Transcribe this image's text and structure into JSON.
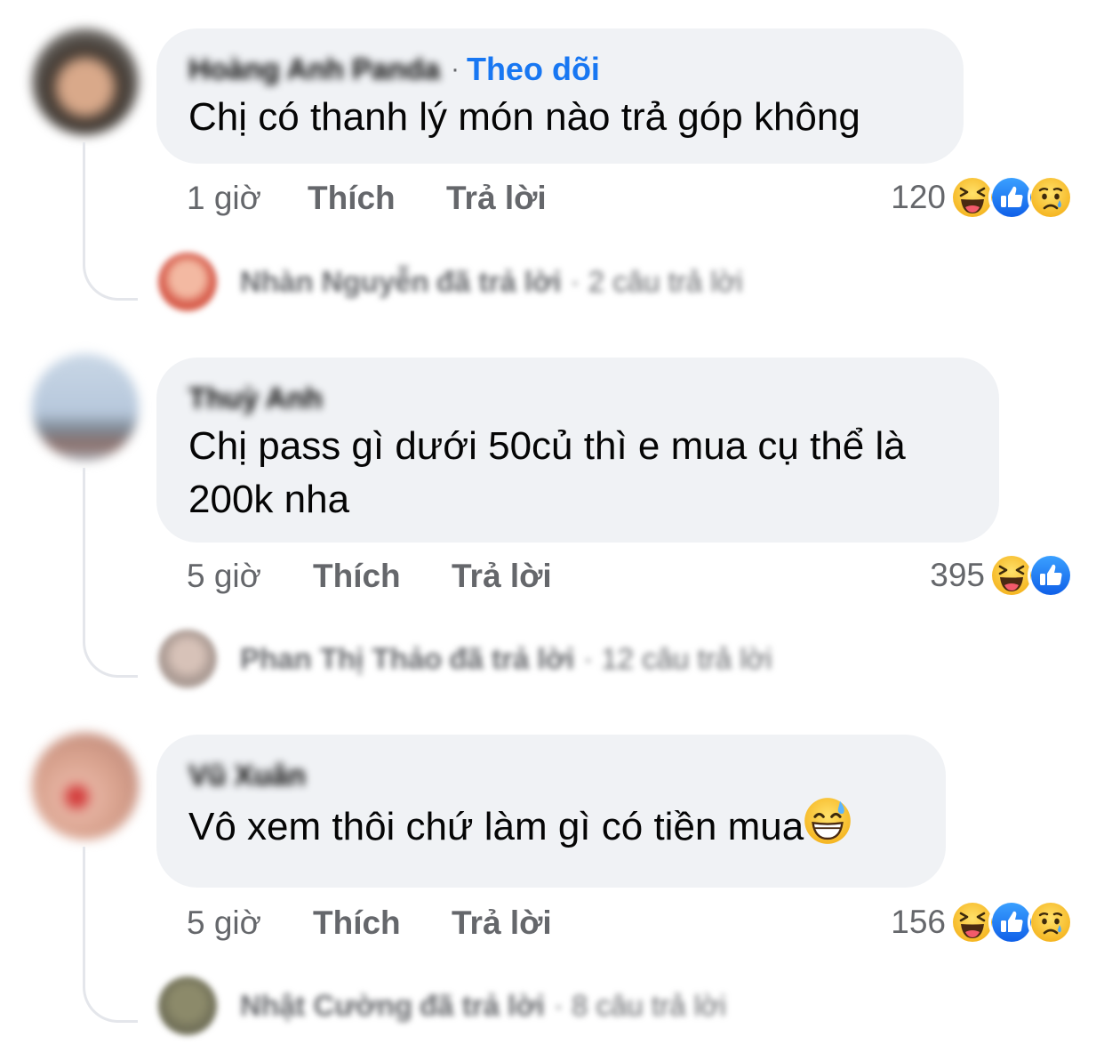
{
  "comments": [
    {
      "author": "Hoàng Anh Panda",
      "follow_label": "Theo dõi",
      "text": "Chị có thanh lý món nào trả góp không",
      "time": "1 giờ",
      "like_label": "Thích",
      "reply_label": "Trả lời",
      "reaction_count": "120",
      "reactions": [
        "haha-icon",
        "like-icon",
        "sad-icon"
      ],
      "replies_summary": {
        "name": "Nhàn Nguyễn",
        "verb": "đã trả lời",
        "count": "· 2 câu trả lời"
      }
    },
    {
      "author": "Thuỳ Anh",
      "text": "Chị pass gì dưới 50củ thì e mua cụ thể là 200k nha",
      "time": "5 giờ",
      "like_label": "Thích",
      "reply_label": "Trả lời",
      "reaction_count": "395",
      "reactions": [
        "haha-icon",
        "like-icon"
      ],
      "replies_summary": {
        "name": "Phan Thị Thảo",
        "verb": "đã trả lời",
        "count": "· 12 câu trả lời"
      }
    },
    {
      "author": "Vũ Xuân",
      "text": "Vô xem thôi chứ làm gì có tiền mua",
      "inline_emoji": "grinning-sweat-icon",
      "time": "5 giờ",
      "like_label": "Thích",
      "reply_label": "Trả lời",
      "reaction_count": "156",
      "reactions": [
        "haha-icon",
        "like-icon",
        "sad-icon"
      ],
      "replies_summary": {
        "name": "Nhật Cường",
        "verb": "đã trả lời",
        "count": "· 8 câu trả lời"
      }
    }
  ],
  "colors": {
    "bubble": "#f0f2f5",
    "follow": "#1877f2",
    "secondary_text": "#65676b",
    "like_blue": "#1877f2",
    "emoji_yellow": "#f7c23c"
  }
}
